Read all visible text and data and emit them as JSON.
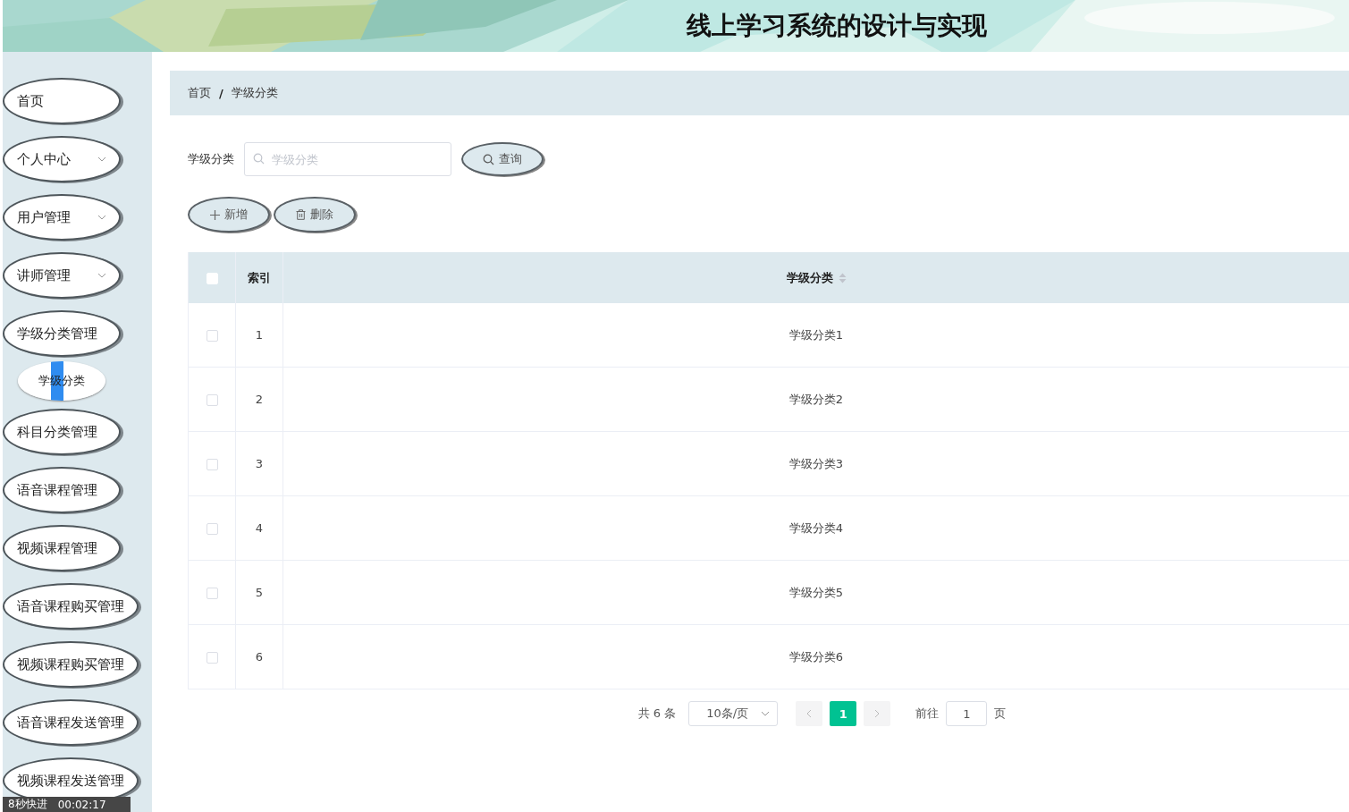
{
  "header": {
    "title": "线上学习系统的设计与实现"
  },
  "sidebar": {
    "items": [
      {
        "label": "首页"
      },
      {
        "label": "个人中心",
        "expanded": false
      },
      {
        "label": "用户管理",
        "expanded": false
      },
      {
        "label": "讲师管理",
        "expanded": false
      },
      {
        "label": "学级分类管理",
        "expanded": true,
        "children": [
          {
            "label": "学级分类",
            "selected": true
          }
        ]
      },
      {
        "label": "科目分类管理"
      },
      {
        "label": "语音课程管理"
      },
      {
        "label": "视频课程管理"
      },
      {
        "label": "语音课程购买管理"
      },
      {
        "label": "视频课程购买管理"
      },
      {
        "label": "语音课程发送管理"
      },
      {
        "label": "视频课程发送管理"
      }
    ]
  },
  "breadcrumb": {
    "items": [
      "首页",
      "学级分类"
    ],
    "separator": "/"
  },
  "search": {
    "label": "学级分类",
    "placeholder": "学级分类",
    "button": "查询"
  },
  "actions": [
    {
      "kind": "add",
      "label": "新增"
    },
    {
      "kind": "delete",
      "label": "删除"
    }
  ],
  "table": {
    "header_checked": false,
    "columns": [
      {
        "label": "索引",
        "sortable": false
      },
      {
        "label": "学级分类",
        "sortable": true
      }
    ],
    "rows": [
      {
        "checked": false,
        "cells": [
          "1",
          "学级分类1"
        ]
      },
      {
        "checked": false,
        "cells": [
          "2",
          "学级分类2"
        ]
      },
      {
        "checked": false,
        "cells": [
          "3",
          "学级分类3"
        ]
      },
      {
        "checked": false,
        "cells": [
          "4",
          "学级分类4"
        ]
      },
      {
        "checked": false,
        "cells": [
          "5",
          "学级分类5"
        ]
      },
      {
        "checked": false,
        "cells": [
          "6",
          "学级分类6"
        ]
      }
    ]
  },
  "pagination": {
    "total": "共 6 条",
    "page_size": "10条/页",
    "pages": [
      {
        "label": "1",
        "selected": true
      }
    ],
    "goto_label": "前往",
    "goto_value": "1",
    "goto_suffix": "页"
  },
  "recorder_bar": {
    "speed": "8秒快进",
    "time": "00:02:17"
  }
}
